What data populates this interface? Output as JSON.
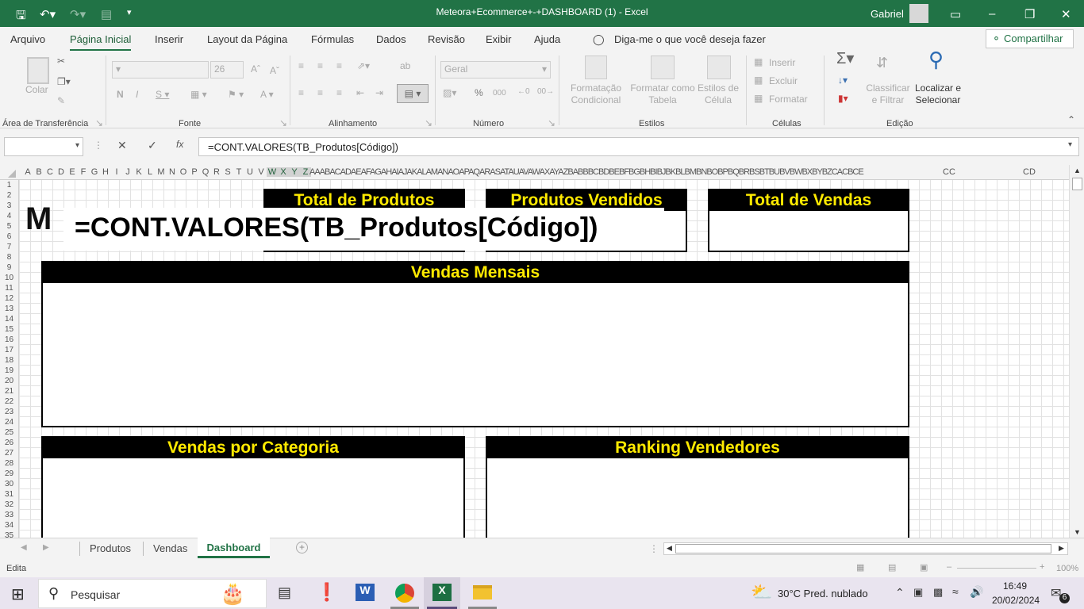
{
  "titlebar": {
    "title": "Meteora+Ecommerce+-+DASHBOARD (1)  -  Excel",
    "user": "Gabriel"
  },
  "tabs": [
    "Arquivo",
    "Página Inicial",
    "Inserir",
    "Layout da Página",
    "Fórmulas",
    "Dados",
    "Revisão",
    "Exibir",
    "Ajuda"
  ],
  "tell_me": "Diga-me o que você deseja fazer",
  "share": "Compartilhar",
  "ribbon": {
    "paste": "Colar",
    "font_size": "26",
    "number_format": "Geral",
    "cond_format": "Formatação Condicional",
    "format_table": "Formatar como Tabela",
    "cell_styles": "Estilos de Célula",
    "insert": "Inserir",
    "delete": "Excluir",
    "format": "Formatar",
    "sort_filter": "Classificar e Filtrar",
    "find_select": "Localizar e Selecionar",
    "groups": [
      "Área de Transferência",
      "Fonte",
      "Alinhamento",
      "Número",
      "Estilos",
      "Células",
      "Edição"
    ]
  },
  "formula_bar": {
    "content": "=CONT.VALORES(TB_Produtos[Código])"
  },
  "columns": [
    "A",
    "B",
    "C",
    "D",
    "E",
    "F",
    "G",
    "H",
    "I",
    "J",
    "K",
    "L",
    "M",
    "N",
    "O",
    "P",
    "Q",
    "R",
    "S",
    "T",
    "U",
    "V",
    "W",
    "X",
    "Y",
    "Z"
  ],
  "columns_tail": "AAABACADAEAFAGAHAIAJAKALAMANAOAPAQARASATAUAVAWAXAYAZBABBBCBDBEBFBGBHBIBJBKBLBMBNBOBPBQBRBSBTBUBVBWBXBYBZCACBCE",
  "columns_far": [
    "CC",
    "CD"
  ],
  "rows": [
    "1",
    "2",
    "3",
    "4",
    "5",
    "6",
    "7",
    "8",
    "9",
    "10",
    "11",
    "12",
    "13",
    "14",
    "15",
    "16",
    "17",
    "18",
    "19",
    "20",
    "21",
    "22",
    "23",
    "24",
    "25",
    "26",
    "27",
    "28",
    "29",
    "30",
    "31",
    "32",
    "33",
    "34",
    "35"
  ],
  "cards": {
    "total_produtos": "Total de Produtos",
    "produtos_vendidos": "Produtos Vendidos",
    "total_vendas": "Total de Vendas",
    "vendas_mensais": "Vendas Mensais",
    "vendas_categoria": "Vendas por Categoria",
    "ranking": "Ranking Vendedores"
  },
  "overlay": {
    "logo": "M",
    "formula": "=CONT.VALORES(TB_Produtos[Código])"
  },
  "sheets": [
    "Produtos",
    "Vendas",
    "Dashboard"
  ],
  "status": {
    "mode": "Edita",
    "zoom": "100%"
  },
  "taskbar": {
    "search": "Pesquisar",
    "weather": "30°C  Pred. nublado",
    "time": "16:49",
    "date": "20/02/2024",
    "notifications": "6"
  },
  "colors": {
    "excel_green": "#217346",
    "card_header": "#000000",
    "card_title": "#ffea00"
  }
}
